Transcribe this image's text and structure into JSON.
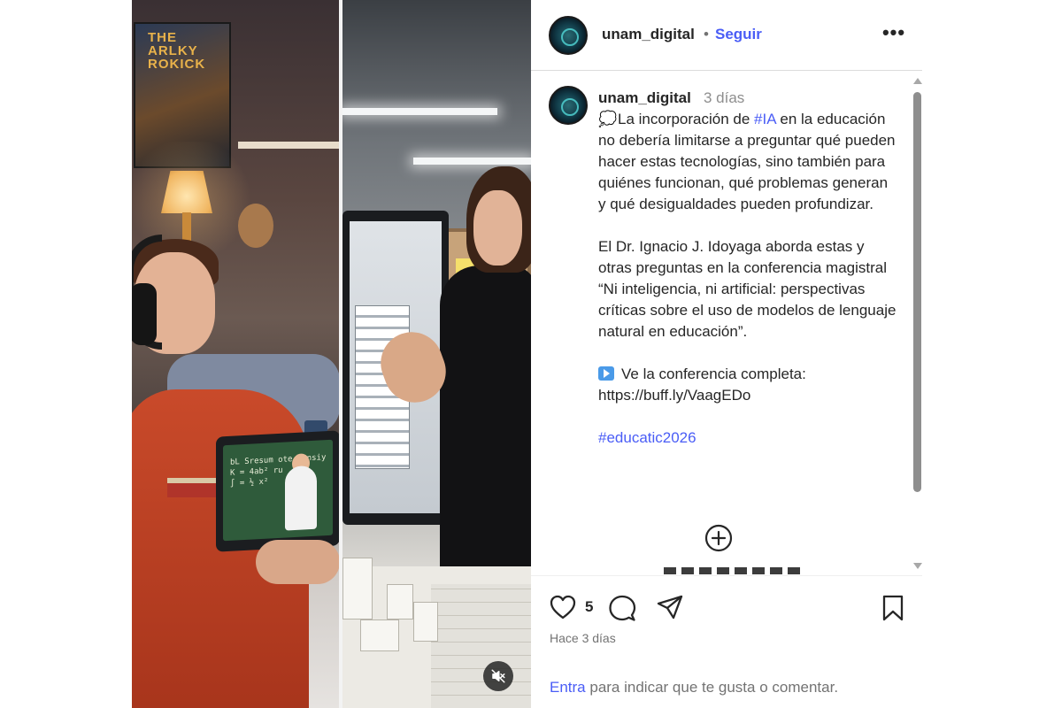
{
  "media": {
    "poster_title": "THE\nARLKY\nROKICK",
    "tablet_text": "bL Sresum ote sensiy\nK = 4ab² ru\n∫ = ½ x²",
    "mute_icon": "speaker-muted-icon"
  },
  "header": {
    "username": "unam_digital",
    "separator": "•",
    "follow_label": "Seguir",
    "more_label": "•••"
  },
  "post": {
    "username": "unam_digital",
    "time": "3 días",
    "caption": {
      "p1_before": "La incorporación de ",
      "p1_tag": "#IA",
      "p1_after": " en la educación no debería limitarse a preguntar qué pueden hacer estas tecnologías, sino también para quiénes funcionan, qué problemas generan y qué desigualdades pueden profundizar.",
      "p2": "El Dr. Ignacio J. Idoyaga aborda estas y otras preguntas en la conferencia magistral “Ni inteligencia, ni artificial: perspectivas críticas sobre el uso de modelos de lenguaje natural en educación”.",
      "p3_line1": "Ve la conferencia completa:",
      "p3_link": "https://buff.ly/VaagEDo",
      "hashtag": "#educatic2026"
    },
    "load_more_icon": "plus-circle-icon"
  },
  "actions": {
    "like_icon": "heart-icon",
    "like_count": "5",
    "comment_icon": "comment-icon",
    "share_icon": "send-icon",
    "save_icon": "bookmark-icon",
    "time_ago": "Hace 3 días",
    "login_link": "Entra",
    "login_text": " para indicar que te gusta o comentar."
  },
  "colors": {
    "link_blue": "#4a5df6",
    "text": "#262626",
    "muted": "#737373"
  }
}
